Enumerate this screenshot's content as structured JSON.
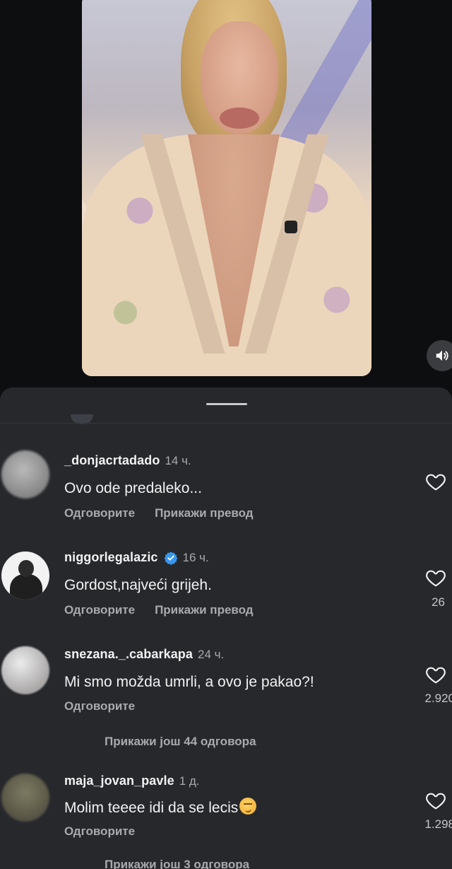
{
  "video": {
    "sound_icon": "speaker-icon"
  },
  "comments": [
    {
      "username": "_donjacrtadado",
      "time": "14 ч.",
      "text": "Ovo ode predaleko...",
      "reply_label": "Одговорите",
      "translate_label": "Прикажи превод",
      "likes": "",
      "verified": false
    },
    {
      "username": "niggorlegalazic",
      "time": "16 ч.",
      "text": "Gordost,najveći grijeh.",
      "reply_label": "Одговорите",
      "translate_label": "Прикажи превод",
      "likes": "26",
      "verified": true
    },
    {
      "username": "snezana._.cabarkapa",
      "time": "24 ч.",
      "text": "Mi smo možda umrli, a ovo je pakao?!",
      "reply_label": "Одговорите",
      "likes": "2.920",
      "verified": false,
      "more_replies": "Прикажи још 44 одговора"
    },
    {
      "username": "maja_jovan_pavle",
      "time": "1 д.",
      "text": "Molim teeee idi da se lecis",
      "reply_label": "Одговорите",
      "likes": "1.298",
      "verified": false,
      "more_replies": "Прикажи још 3 одговора"
    }
  ],
  "colors": {
    "background": "#0d0e10",
    "sheet": "#26282c",
    "verified": "#3797f0",
    "secondary_text": "#a8aaae"
  }
}
